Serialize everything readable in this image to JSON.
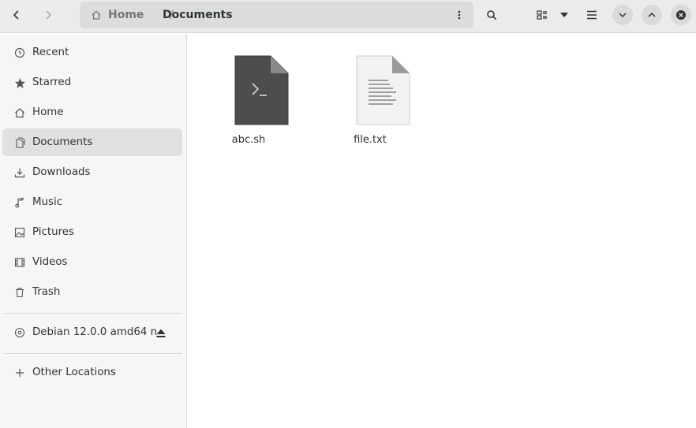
{
  "header": {
    "path": {
      "home_label": "Home",
      "separator": "/",
      "current_label": "Documents"
    }
  },
  "sidebar": {
    "items": [
      {
        "label": "Recent",
        "icon": "clock-icon"
      },
      {
        "label": "Starred",
        "icon": "star-icon"
      },
      {
        "label": "Home",
        "icon": "home-icon"
      },
      {
        "label": "Documents",
        "icon": "documents-icon",
        "selected": true
      },
      {
        "label": "Downloads",
        "icon": "downloads-icon"
      },
      {
        "label": "Music",
        "icon": "music-icon"
      },
      {
        "label": "Pictures",
        "icon": "pictures-icon"
      },
      {
        "label": "Videos",
        "icon": "videos-icon"
      },
      {
        "label": "Trash",
        "icon": "trash-icon"
      }
    ],
    "devices": [
      {
        "label": "Debian 12.0.0 amd64 n",
        "icon": "disc-icon",
        "eject_icon": "eject-icon"
      }
    ],
    "other": {
      "label": "Other Locations",
      "icon": "plus-icon"
    }
  },
  "files": [
    {
      "name": "abc.sh",
      "icon": "terminal-script-icon"
    },
    {
      "name": "file.txt",
      "icon": "text-file-icon"
    }
  ],
  "colors": {
    "selected_bg": "#e0e0e0",
    "sidebar_bg": "#f6f6f6",
    "header_bg": "#ebebeb",
    "script_icon": "#4d4d4d"
  }
}
